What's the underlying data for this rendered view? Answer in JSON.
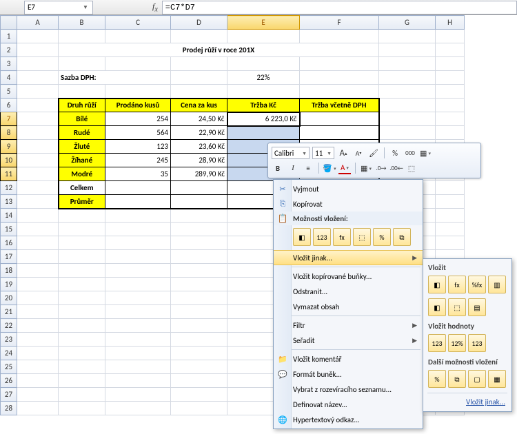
{
  "nameBox": "E7",
  "formula": "=C7*D7",
  "colHeaders": [
    "A",
    "B",
    "C",
    "D",
    "E",
    "F",
    "G",
    "H"
  ],
  "activeCol": "E",
  "activeRow": 7,
  "selRows": [
    7,
    8,
    9,
    10,
    11
  ],
  "title": "Prodej růží v roce 201X",
  "sazbaLabel": "Sazba DPH:",
  "sazbaVal": "22%",
  "headers": {
    "druh": "Druh růží",
    "prodano": "Prodáno kusů",
    "cena": "Cena za kus",
    "trzba": "Tržba Kč",
    "trzbaDph": "Tržba včetně DPH"
  },
  "rows": [
    {
      "name": "Bílé",
      "ks": "254",
      "cena": "24,50 Kč",
      "trzba": "6 223,0 Kč"
    },
    {
      "name": "Rudé",
      "ks": "564",
      "cena": "22,90 Kč",
      "trzba": ""
    },
    {
      "name": "Žluté",
      "ks": "123",
      "cena": "23,60 Kč",
      "trzba": ""
    },
    {
      "name": "Žíhané",
      "ks": "245",
      "cena": "28,90 Kč",
      "trzba": ""
    },
    {
      "name": "Modré",
      "ks": "35",
      "cena": "289,90 Kč",
      "trzba": ""
    }
  ],
  "sumLabel": "Celkem",
  "avgLabel": "Průměr",
  "miniToolbar": {
    "font": "Calibri",
    "size": "11",
    "inc": "A",
    "dec": "A",
    "pct": "%",
    "th": "000",
    "bold": "B",
    "italic": "I"
  },
  "ctx": {
    "cut": "Vyjmout",
    "copy": "Kopírovat",
    "pasteOptions": "Možnosti vložení:",
    "pasteSpecial": "Vložit jinak...",
    "insertCopied": "Vložit kopírované buňky...",
    "delete": "Odstranit...",
    "clear": "Vymazat obsah",
    "filter": "Filtr",
    "sort": "Seřadit",
    "comment": "Vložit komentář",
    "format": "Formát buněk...",
    "dropdown": "Vybrat z rozevíracího seznamu...",
    "defName": "Definovat název...",
    "hyperlink": "Hypertextový odkaz...",
    "pi": [
      "◧",
      "123",
      "fx",
      "⬚",
      "%",
      "⧉"
    ]
  },
  "sub": {
    "h1": "Vložit",
    "h2": "Vložit hodnoty",
    "h3": "Další možnosti vložení",
    "link": "Vložit jinak...",
    "r1": [
      "◧",
      "fx",
      "%fx",
      "▥"
    ],
    "r2": [
      "◧",
      "⬚",
      "▤"
    ],
    "r3": [
      "123",
      "12%",
      "123"
    ],
    "r4": [
      "%",
      "⧉",
      "▢",
      "▦"
    ]
  }
}
